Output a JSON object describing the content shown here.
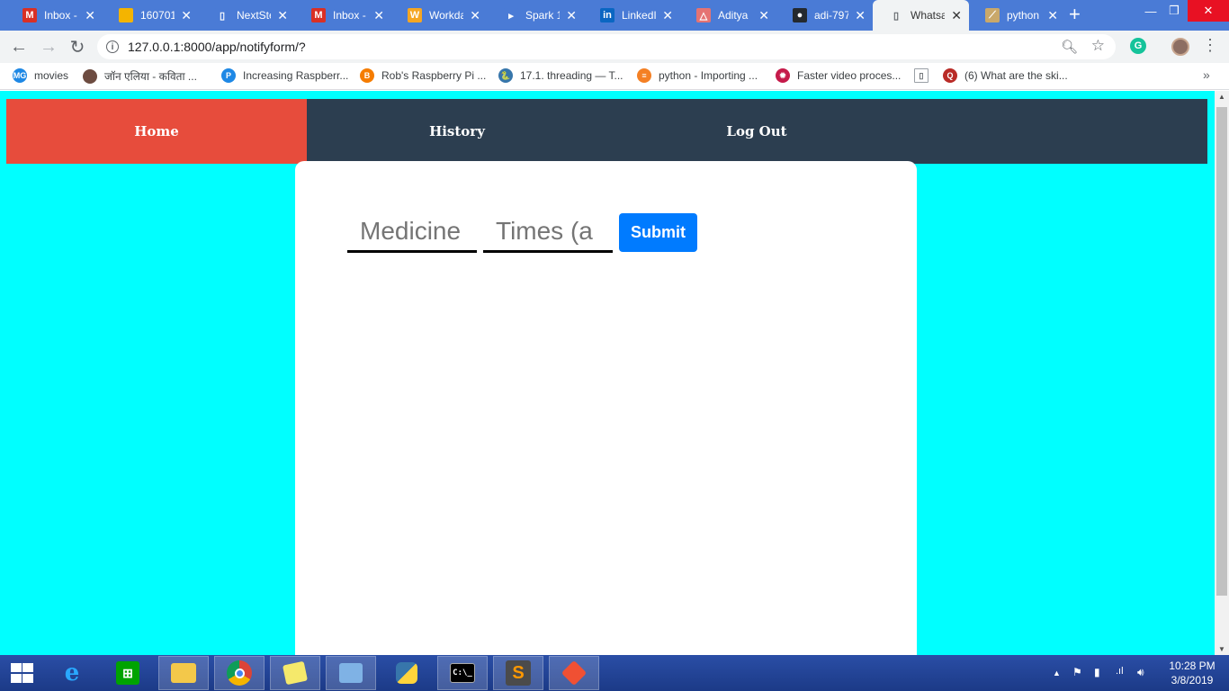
{
  "browser": {
    "tabs": [
      {
        "title": "Inbox -",
        "icon": "gmail-icon",
        "icon_color": "#d93025",
        "glyph": "M"
      },
      {
        "title": "160701",
        "icon": "slides-icon",
        "icon_color": "#f4b400",
        "glyph": ""
      },
      {
        "title": "NextSte",
        "icon": "page-icon",
        "icon_color": "#4a7bd6",
        "glyph": "▯"
      },
      {
        "title": "Inbox -",
        "icon": "gmail-icon",
        "icon_color": "#d93025",
        "glyph": "M"
      },
      {
        "title": "Workda",
        "icon": "workday-icon",
        "icon_color": "#f5a623",
        "glyph": "W"
      },
      {
        "title": "Spark 1",
        "icon": "spark-icon",
        "icon_color": "#4a7bd6",
        "glyph": "▸"
      },
      {
        "title": "LinkedI",
        "icon": "linkedin-icon",
        "icon_color": "#0a66c2",
        "glyph": "in"
      },
      {
        "title": "Aditya",
        "icon": "triangle-icon",
        "icon_color": "#e57373",
        "glyph": "△"
      },
      {
        "title": "adi-797",
        "icon": "github-icon",
        "icon_color": "#24292e",
        "glyph": "●"
      },
      {
        "title": "Whatsa",
        "icon": "page-icon",
        "icon_color": "#f1f3f4",
        "glyph": "▯"
      },
      {
        "title": "python",
        "icon": "python-icon",
        "icon_color": "#c9a86a",
        "glyph": "⟋"
      }
    ],
    "url": "127.0.0.1:8000/app/notifyform/?",
    "bookmarks": [
      {
        "label": "movies",
        "icon": "mg-icon",
        "icon_color": "#1e88e5",
        "glyph": "MG"
      },
      {
        "label": "जॉन एलिया - कविता ...",
        "icon": "avatar-icon",
        "icon_color": "#6d4c41",
        "glyph": ""
      },
      {
        "label": "Increasing Raspberr...",
        "icon": "p-icon",
        "icon_color": "#1e88e5",
        "glyph": "P"
      },
      {
        "label": "Rob's Raspberry Pi ...",
        "icon": "blogger-icon",
        "icon_color": "#f57c00",
        "glyph": "B"
      },
      {
        "label": "17.1. threading — T...",
        "icon": "python-icon",
        "icon_color": "#3776ab",
        "glyph": "🐍"
      },
      {
        "label": "python - Importing ...",
        "icon": "stackoverflow-icon",
        "icon_color": "#f48024",
        "glyph": "≡"
      },
      {
        "label": "Faster video proces...",
        "icon": "raspberry-icon",
        "icon_color": "#c51a4a",
        "glyph": "✹"
      },
      {
        "label": "",
        "icon": "page-icon",
        "icon_color": "#ffffff",
        "glyph": "▯"
      },
      {
        "label": "(6) What are the ski...",
        "icon": "quora-icon",
        "icon_color": "#b92b27",
        "glyph": "Q"
      }
    ]
  },
  "app": {
    "nav": {
      "home": "Home",
      "history": "History",
      "logout": "Log Out"
    },
    "form": {
      "medicine_placeholder": "Medicine",
      "times_placeholder": "Times (a",
      "submit_label": "Submit"
    }
  },
  "taskbar": {
    "apps": [
      "ie",
      "store",
      "explorer",
      "chrome",
      "sticky-notes",
      "control-panel",
      "python",
      "cmd",
      "sublime",
      "git"
    ],
    "time": "10:28 PM",
    "date": "3/8/2019"
  },
  "colors": {
    "page_bg": "#00ffff",
    "navbar_bg": "#2c3e50",
    "nav_active": "#e74c3c",
    "submit_bg": "#007bff"
  }
}
